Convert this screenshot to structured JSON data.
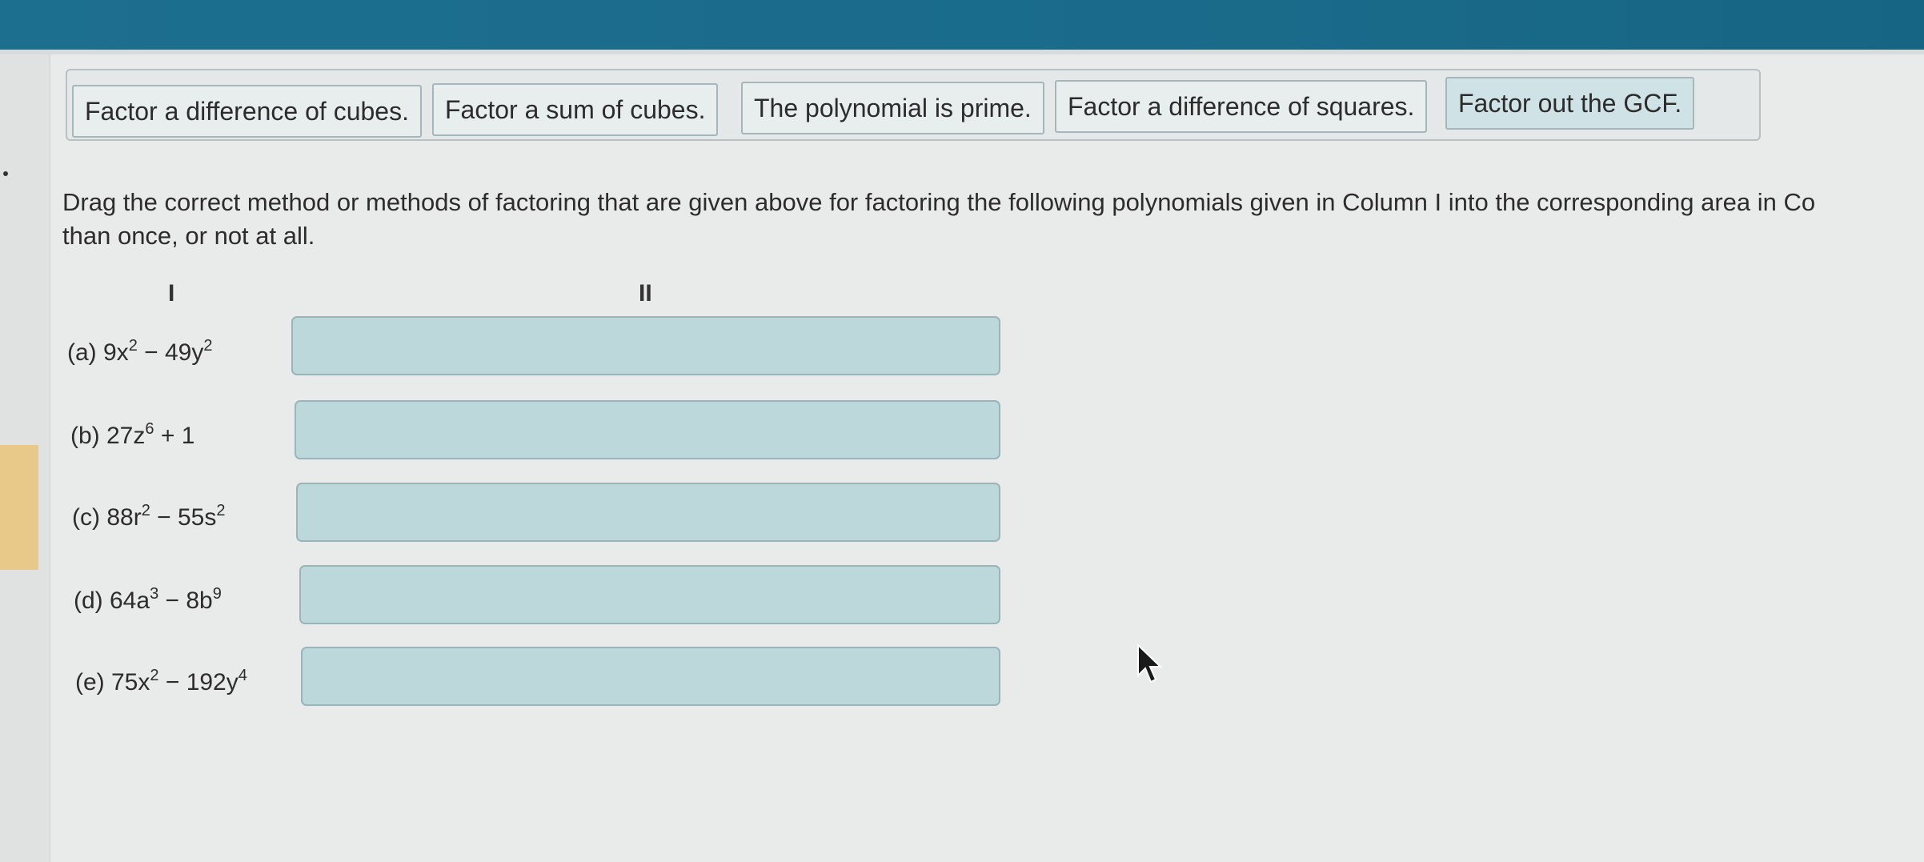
{
  "methods": [
    "Factor a difference of cubes.",
    "Factor a sum of cubes.",
    "The polynomial is prime.",
    "Factor a difference of squares.",
    "Factor out the GCF."
  ],
  "instructions": {
    "line1": "Drag the correct method or methods of factoring that are given above for factoring the following polynomials given in Column I into the corresponding area in Co",
    "line2": "than once, or not at all."
  },
  "columns": {
    "col1": "I",
    "col2": "II"
  },
  "items": [
    {
      "letter": "(a)",
      "terms": [
        {
          "t": "9x"
        },
        {
          "s": "2"
        },
        {
          "t": " − 49y"
        },
        {
          "s": "2"
        }
      ]
    },
    {
      "letter": "(b)",
      "terms": [
        {
          "t": "27z"
        },
        {
          "s": "6"
        },
        {
          "t": " + 1"
        }
      ]
    },
    {
      "letter": "(c)",
      "terms": [
        {
          "t": "88r"
        },
        {
          "s": "2"
        },
        {
          "t": " − 55s"
        },
        {
          "s": "2"
        }
      ]
    },
    {
      "letter": "(d)",
      "terms": [
        {
          "t": "64a"
        },
        {
          "s": "3"
        },
        {
          "t": " − 8b"
        },
        {
          "s": "9"
        }
      ]
    },
    {
      "letter": "(e)",
      "terms": [
        {
          "t": "75x"
        },
        {
          "s": "2"
        },
        {
          "t": " − 192y"
        },
        {
          "s": "4"
        }
      ]
    }
  ],
  "colors": {
    "topbar": "#1a6b8b",
    "dropzone": "#bcd8db",
    "tile": "#e8edee"
  }
}
